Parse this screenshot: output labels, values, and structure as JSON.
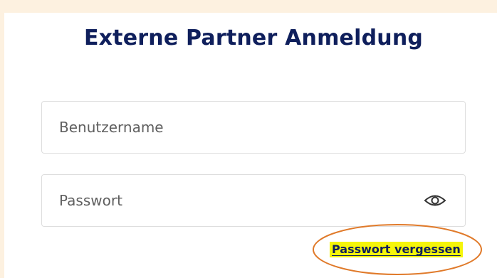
{
  "login": {
    "title": "Externe Partner Anmeldung",
    "username_placeholder": "Benutzername",
    "password_placeholder": "Passwort",
    "forgot_link": "Passwort vergessen",
    "show_password_icon": "eye-icon"
  },
  "colors": {
    "page_background": "#fdf1e0",
    "title_text": "#0f1f5c",
    "link_highlight": "#f5f50a",
    "annotation_ring": "#e07a2a"
  }
}
